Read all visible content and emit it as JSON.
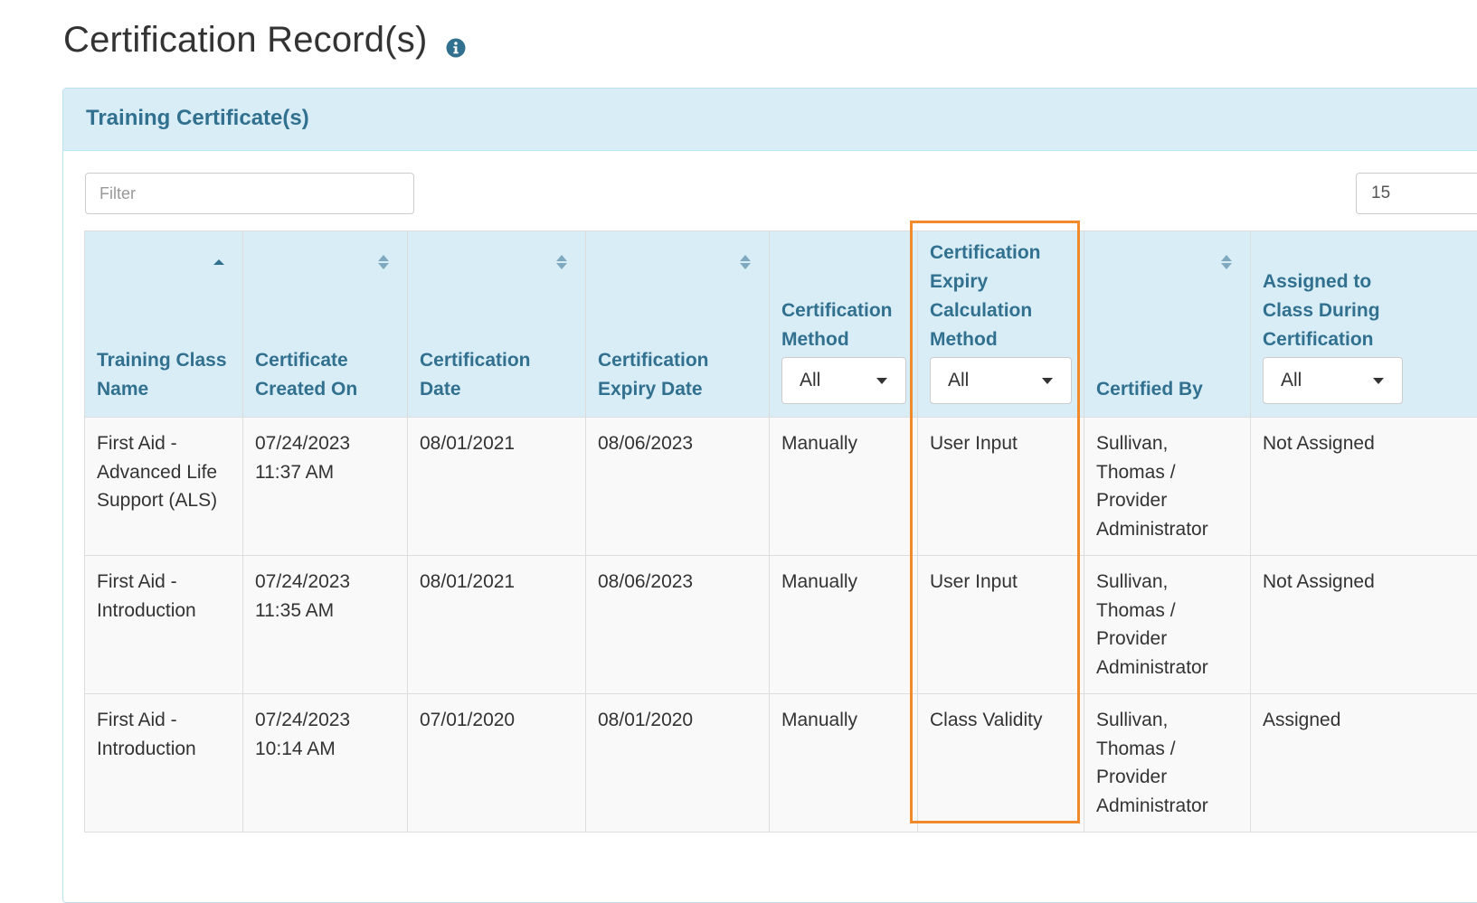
{
  "page": {
    "title": "Certification Record(s)",
    "info_icon": "info-circle-icon"
  },
  "panel": {
    "title": "Training Certificate(s)"
  },
  "filter": {
    "placeholder": "Filter",
    "value": ""
  },
  "page_size": {
    "value": "15"
  },
  "colors": {
    "header_bg": "#d9edf7",
    "header_text": "#31708f",
    "row_bg": "#f9f9f9",
    "highlight": "#f08a2a"
  },
  "table": {
    "columns": [
      {
        "label": "Training Class Name",
        "sort": "asc",
        "sort_icon": "sort-asc-icon"
      },
      {
        "label": "Certificate Created On",
        "sort": "none",
        "sort_icon": "sort-both-icon"
      },
      {
        "label": "Certification Date",
        "sort": "none",
        "sort_icon": "sort-both-icon"
      },
      {
        "label": "Certification Expiry Date",
        "sort": "none",
        "sort_icon": "sort-both-icon"
      },
      {
        "label": "Certification Method",
        "filter_value": "All",
        "filter_icon": "caret-down-icon"
      },
      {
        "label": "Certification Expiry Calculation Method",
        "filter_value": "All",
        "filter_icon": "caret-down-icon"
      },
      {
        "label": "Certified By",
        "sort": "none",
        "sort_icon": "sort-both-icon"
      },
      {
        "label": "Assigned to Class During Certification",
        "filter_value": "All",
        "filter_icon": "caret-down-icon"
      }
    ],
    "rows": [
      {
        "class_name": "First Aid - Advanced Life Support (ALS)",
        "created_on": "07/24/2023 11:37 AM",
        "cert_date": "08/01/2021",
        "expiry_date": "08/06/2023",
        "method": "Manually",
        "expiry_calc": "User Input",
        "certified_by": "Sullivan, Thomas / Provider Administrator",
        "assigned": "Not Assigned"
      },
      {
        "class_name": "First Aid - Introduction",
        "created_on": "07/24/2023 11:35 AM",
        "cert_date": "08/01/2021",
        "expiry_date": "08/06/2023",
        "method": "Manually",
        "expiry_calc": "User Input",
        "certified_by": "Sullivan, Thomas / Provider Administrator",
        "assigned": "Not Assigned"
      },
      {
        "class_name": "First Aid - Introduction",
        "created_on": "07/24/2023 10:14 AM",
        "cert_date": "07/01/2020",
        "expiry_date": "08/01/2020",
        "method": "Manually",
        "expiry_calc": "Class Validity",
        "certified_by": "Sullivan, Thomas / Provider Administrator",
        "assigned": "Assigned"
      }
    ]
  }
}
